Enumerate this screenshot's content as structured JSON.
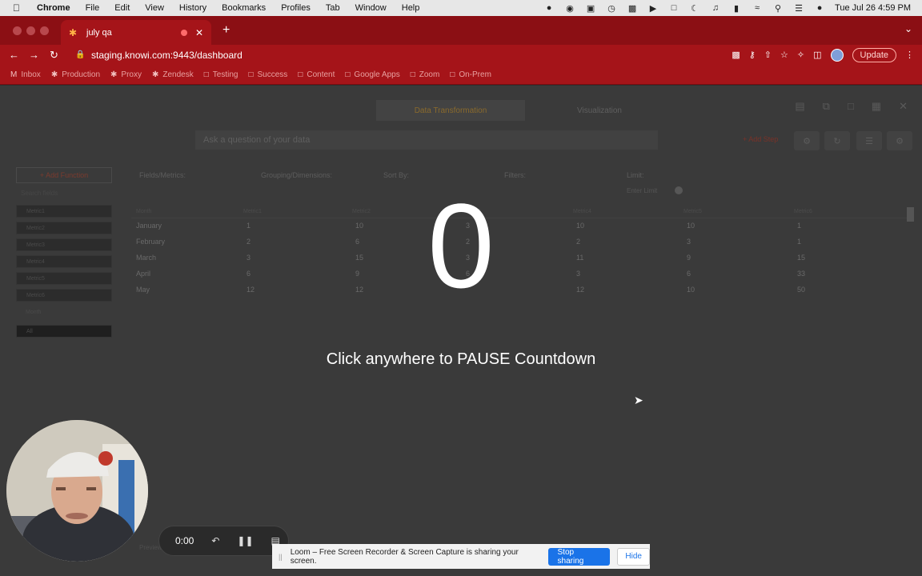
{
  "menubar": {
    "app": "Chrome",
    "items": [
      "File",
      "Edit",
      "View",
      "History",
      "Bookmarks",
      "Profiles",
      "Tab",
      "Window",
      "Help"
    ],
    "datetime": "Tue Jul 26  4:59 PM"
  },
  "tabs": [
    {
      "title": "july qa"
    }
  ],
  "address": {
    "url": "staging.knowi.com:9443/dashboard",
    "update_label": "Update"
  },
  "bookmarks": [
    "Inbox",
    "Production",
    "Proxy",
    "Zendesk",
    "Testing",
    "Success",
    "Content",
    "Google Apps",
    "Zoom",
    "On-Prem"
  ],
  "page": {
    "mode_tabs": [
      "Data Transformation",
      "Visualization"
    ],
    "ask_placeholder": "Ask a question of your data",
    "add_step": "+ Add Step",
    "add_function": "+ Add Function",
    "search": "Search fields",
    "left_items": [
      "Metric1",
      "Metric2",
      "Metric3",
      "Metric4",
      "Metric5",
      "Metric6",
      "Month",
      "All"
    ],
    "field_headers": [
      "Fields/Metrics:",
      "Grouping/Dimensions:",
      "Sort By:",
      "Filters:",
      "Limit:"
    ],
    "limit_placeholder": "Enter Limit",
    "columns": [
      "Month",
      "Metric1",
      "Metric2",
      "Metric3",
      "Metric4",
      "Metric5",
      "Metric6"
    ],
    "rows": [
      [
        "January",
        "1",
        "10",
        "3",
        "10",
        "10",
        "1"
      ],
      [
        "February",
        "2",
        "6",
        "2",
        "2",
        "3",
        "1"
      ],
      [
        "March",
        "3",
        "15",
        "3",
        "11",
        "9",
        "15"
      ],
      [
        "April",
        "6",
        "9",
        "6",
        "3",
        "6",
        "33"
      ],
      [
        "May",
        "12",
        "12",
        "",
        "12",
        "10",
        "50"
      ]
    ],
    "bottom_hint": "Preview"
  },
  "overlay": {
    "countdown": "0",
    "pause_hint": "Click anywhere to PAUSE Countdown"
  },
  "recorder": {
    "time": "0:00"
  },
  "sharebar": {
    "message": "Loom – Free Screen Recorder & Screen Capture is sharing your screen.",
    "stop_label": "Stop sharing",
    "hide_label": "Hide"
  }
}
